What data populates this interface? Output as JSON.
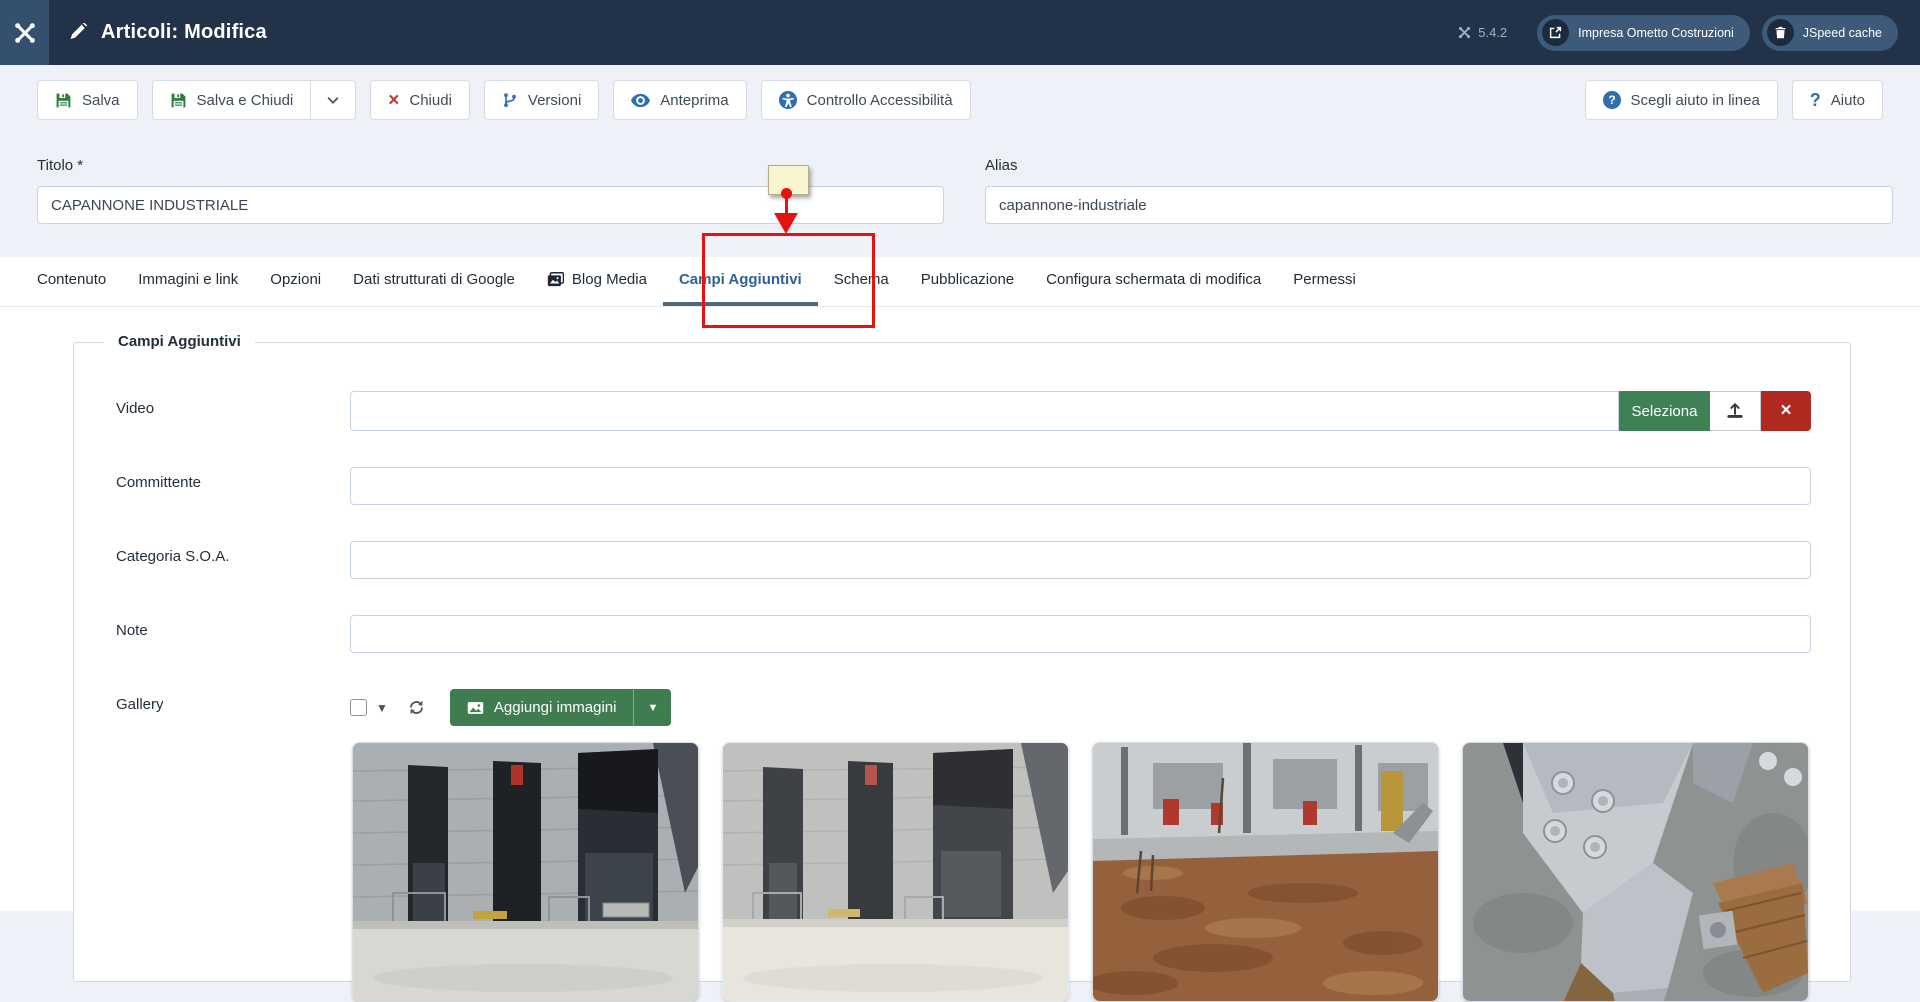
{
  "app": {
    "title": "Articoli: Modifica",
    "version": "5.4.2"
  },
  "header": {
    "pills": [
      {
        "label": "Impresa Ometto Costruzioni",
        "icon": "external-link-icon"
      },
      {
        "label": "JSpeed cache",
        "icon": "trash-icon"
      }
    ]
  },
  "toolbar": {
    "save": "Salva",
    "save_and_close": "Salva e Chiudi",
    "close": "Chiudi",
    "versions": "Versioni",
    "preview": "Anteprima",
    "accessibility_check": "Controllo Accessibilità",
    "choose_online_help": "Scegli aiuto in linea",
    "help": "Aiuto"
  },
  "form": {
    "title": {
      "label": "Titolo *",
      "value": "CAPANNONE INDUSTRIALE"
    },
    "alias": {
      "label": "Alias",
      "value": "capannone-industriale"
    }
  },
  "tabs": [
    {
      "label": "Contenuto"
    },
    {
      "label": "Immagini e link"
    },
    {
      "label": "Opzioni"
    },
    {
      "label": "Dati strutturati di Google"
    },
    {
      "label": "Blog Media",
      "icon": "media-stack-icon"
    },
    {
      "label": "Campi Aggiuntivi",
      "active": true
    },
    {
      "label": "Schema"
    },
    {
      "label": "Pubblicazione"
    },
    {
      "label": "Configura schermata di modifica"
    },
    {
      "label": "Permessi"
    }
  ],
  "fieldset": {
    "legend": "Campi Aggiuntivi",
    "video": {
      "label": "Video",
      "value": "",
      "select_button": "Seleziona"
    },
    "committente": {
      "label": "Committente",
      "value": ""
    },
    "categoria_soa": {
      "label": "Categoria S.O.A.",
      "value": ""
    },
    "note": {
      "label": "Note",
      "value": ""
    },
    "gallery": {
      "label": "Gallery",
      "add_button": "Aggiungi immagini",
      "images": [
        {
          "name": "industrial-facade-doors-photo"
        },
        {
          "name": "industrial-facade-doors-photo-light"
        },
        {
          "name": "excavation-dirt-floor-photo"
        },
        {
          "name": "steel-anchor-plate-photo"
        }
      ]
    }
  },
  "annotation": {
    "highlighted_tab": "Campi Aggiuntivi"
  },
  "colors": {
    "header_bg": "#223349",
    "header_pill": "#3d5a7a",
    "accent_green": "#3f8154",
    "danger_red": "#b02a21",
    "annotation_red": "#e41310",
    "active_tab_blue": "#2f6297",
    "icon_blue": "#2f6fae",
    "page_bg": "#eef2f8"
  }
}
